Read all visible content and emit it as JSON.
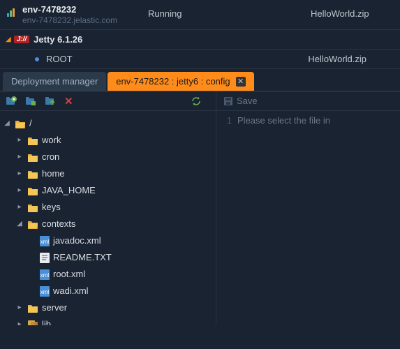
{
  "env": {
    "name": "env-7478232",
    "domain": "env-7478232.jelastic.com",
    "status": "Running",
    "deployment": "HelloWorld.zip"
  },
  "server": {
    "badge": "J://",
    "name": "Jetty 6.1.26"
  },
  "context": {
    "name": "ROOT",
    "deployment": "HelloWorld.zip"
  },
  "tabs": {
    "deployment": "Deployment manager",
    "config": "env-7478232 : jetty6 : config"
  },
  "editor": {
    "save_label": "Save",
    "line_no": "1",
    "placeholder": "Please select the file in"
  },
  "tree": {
    "root": "/",
    "items": [
      {
        "label": "work",
        "type": "folder",
        "expanded": false,
        "depth": 1
      },
      {
        "label": "cron",
        "type": "folder",
        "expanded": false,
        "depth": 1
      },
      {
        "label": "home",
        "type": "folder",
        "expanded": false,
        "depth": 1
      },
      {
        "label": "JAVA_HOME",
        "type": "folder",
        "expanded": false,
        "depth": 1
      },
      {
        "label": "keys",
        "type": "folder",
        "expanded": false,
        "depth": 1
      },
      {
        "label": "contexts",
        "type": "folder",
        "expanded": true,
        "depth": 1
      },
      {
        "label": "javadoc.xml",
        "type": "xml",
        "depth": 2
      },
      {
        "label": "README.TXT",
        "type": "txt",
        "depth": 2
      },
      {
        "label": "root.xml",
        "type": "xml",
        "depth": 2
      },
      {
        "label": "wadi.xml",
        "type": "xml",
        "depth": 2
      },
      {
        "label": "server",
        "type": "folder",
        "expanded": false,
        "depth": 1
      },
      {
        "label": "lib",
        "type": "lib",
        "expanded": false,
        "depth": 1
      }
    ]
  }
}
